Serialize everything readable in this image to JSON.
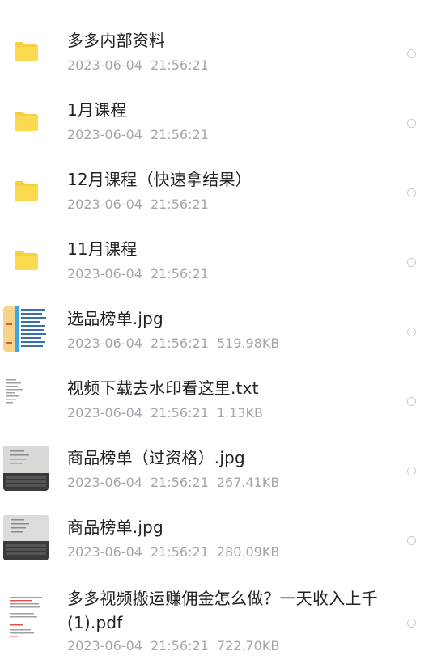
{
  "files": [
    {
      "name": "多多内部资料",
      "date": "2023-06-04",
      "time": "21:56:21",
      "size": "",
      "icon": "folder-icon"
    },
    {
      "name": "1月课程",
      "date": "2023-06-04",
      "time": "21:56:21",
      "size": "",
      "icon": "folder-icon"
    },
    {
      "name": "12月课程（快速拿结果）",
      "date": "2023-06-04",
      "time": "21:56:21",
      "size": "",
      "icon": "folder-icon"
    },
    {
      "name": "11月课程",
      "date": "2023-06-04",
      "time": "21:56:21",
      "size": "",
      "icon": "folder-icon"
    },
    {
      "name": "选品榜单.jpg",
      "date": "2023-06-04",
      "time": "21:56:21",
      "size": "519.98KB",
      "icon": "image-thumbnail"
    },
    {
      "name": "视频下载去水印看这里.txt",
      "date": "2023-06-04",
      "time": "21:56:21",
      "size": "1.13KB",
      "icon": "text-file-thumbnail"
    },
    {
      "name": "商品榜单（过资格）.jpg",
      "date": "2023-06-04",
      "time": "21:56:21",
      "size": "267.41KB",
      "icon": "photo-thumbnail"
    },
    {
      "name": "商品榜单.jpg",
      "date": "2023-06-04",
      "time": "21:56:21",
      "size": "280.09KB",
      "icon": "photo-thumbnail"
    },
    {
      "name": "多多视频搬运赚佣金怎么做？一天收入上千(1).pdf",
      "date": "2023-06-04",
      "time": "21:56:21",
      "size": "722.70KB",
      "icon": "pdf-thumbnail"
    }
  ],
  "colors": {
    "folder": "#fcd34d",
    "folder_tab": "#f7c948",
    "meta": "#a2a7ad",
    "title": "#222222"
  }
}
